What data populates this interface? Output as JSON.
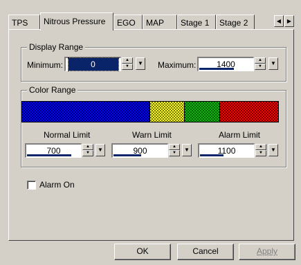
{
  "tabs": [
    {
      "label": "TPS"
    },
    {
      "label": "Nitrous Pressure"
    },
    {
      "label": "EGO"
    },
    {
      "label": "MAP"
    },
    {
      "label": "Stage 1"
    },
    {
      "label": "Stage 2"
    }
  ],
  "active_tab": "Nitrous Pressure",
  "display_range": {
    "title": "Display Range",
    "min_label": "Minimum:",
    "min_value": "0",
    "max_label": "Maximum:",
    "max_value": "1400"
  },
  "color_range": {
    "title": "Color Range",
    "segments": [
      {
        "color": "#0000ff",
        "fraction": 0.5
      },
      {
        "color": "#ffff00",
        "fraction": 0.136
      },
      {
        "color": "#00c000",
        "fraction": 0.136
      },
      {
        "color": "#ff0000",
        "fraction": 0.228
      }
    ],
    "normal_label": "Normal Limit",
    "normal_value": "700",
    "warn_label": "Warn Limit",
    "warn_value": "900",
    "alarm_label": "Alarm Limit",
    "alarm_value": "1100"
  },
  "alarm_on": {
    "label": "Alarm On",
    "checked": false
  },
  "buttons": {
    "ok": "OK",
    "cancel": "Cancel",
    "apply": "Apply"
  },
  "colors": {
    "face": "#d4d0c8",
    "highlight": "#0a246a"
  }
}
